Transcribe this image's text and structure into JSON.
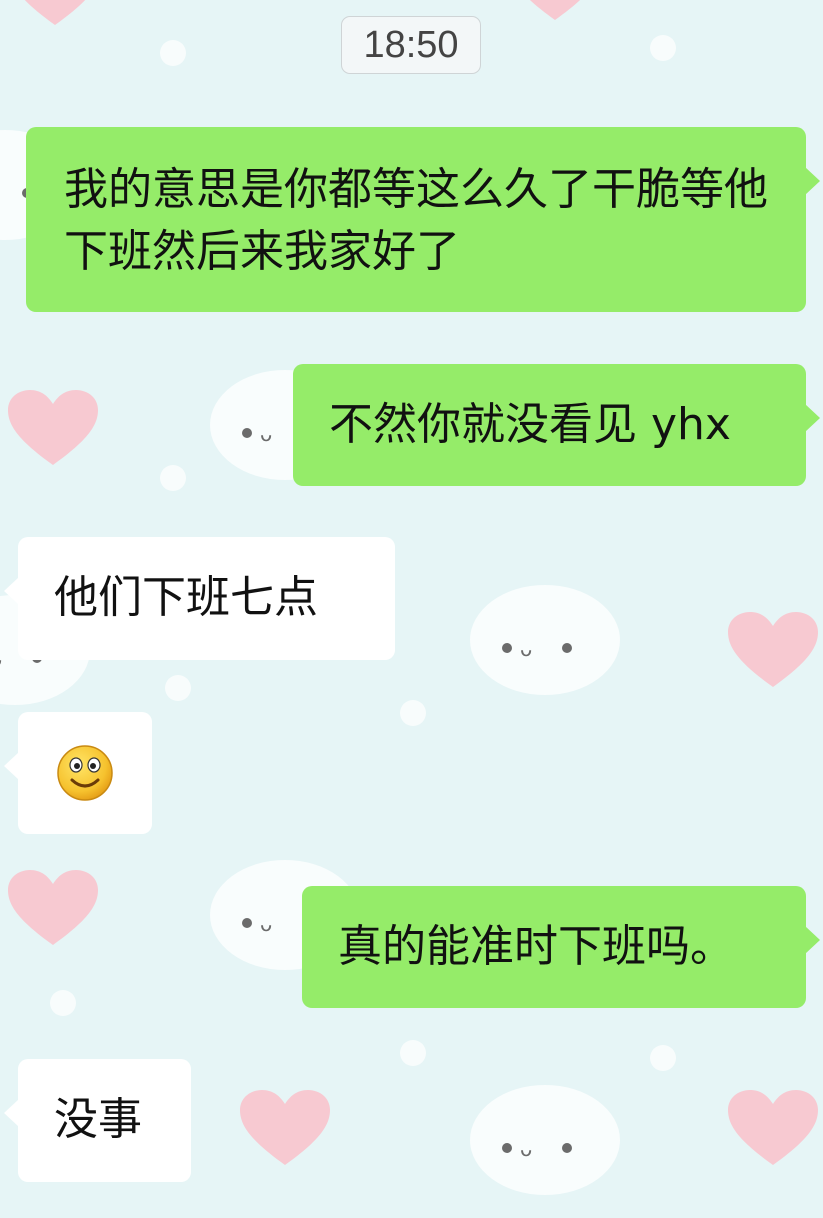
{
  "chat": {
    "timestamp": "18:50",
    "messages": [
      {
        "side": "sent",
        "text": "我的意思是你都等这么久了干脆等他下班然后来我家好了"
      },
      {
        "side": "sent",
        "text": "不然你就没看见 yhx"
      },
      {
        "side": "received",
        "text": "他们下班七点"
      },
      {
        "side": "received",
        "emoji": "smiley-face"
      },
      {
        "side": "sent",
        "text": "真的能准时下班吗。"
      },
      {
        "side": "received",
        "text": "没事"
      }
    ]
  },
  "colors": {
    "sent_bubble": "#95ec69",
    "received_bubble": "#ffffff",
    "background": "#e6f5f6",
    "heart": "#f7c9d1"
  }
}
